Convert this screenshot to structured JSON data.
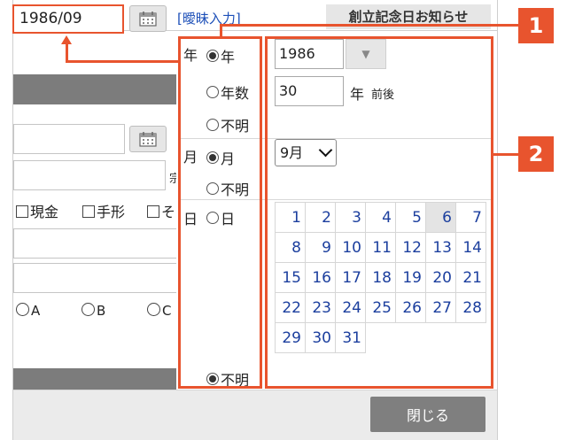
{
  "top": {
    "date_value": "1986/09",
    "fuzzy_link": "[曖昧入力]",
    "notice_button": "創立記念日お知らせ"
  },
  "form": {
    "field2_suffix": "宗",
    "checkboxes": [
      "現金",
      "手形",
      "そ"
    ],
    "radios": [
      "A",
      "B",
      "C"
    ]
  },
  "popup": {
    "badges": [
      "1",
      "2"
    ],
    "year": {
      "label": "年",
      "options": [
        "年",
        "年数",
        "不明"
      ],
      "selected": 0,
      "input_value": "1986",
      "years_value": "30",
      "years_unit": "年",
      "zengo": "前後"
    },
    "month": {
      "label": "月",
      "options": [
        "月",
        "不明"
      ],
      "selected": 0,
      "select_value": "9月"
    },
    "day": {
      "label": "日",
      "options": [
        "日",
        "不明"
      ],
      "selected": 1
    },
    "days": [
      "1",
      "2",
      "3",
      "4",
      "5",
      "6",
      "7",
      "8",
      "9",
      "10",
      "11",
      "12",
      "13",
      "14",
      "15",
      "16",
      "17",
      "18",
      "19",
      "20",
      "21",
      "22",
      "23",
      "24",
      "25",
      "26",
      "27",
      "28",
      "29",
      "30",
      "31"
    ],
    "highlight_day": "6",
    "close_button": "閉じる"
  },
  "colors": {
    "accent": "#e8542e",
    "link": "#1c4fb8",
    "button_gray": "#7f7f7f"
  }
}
